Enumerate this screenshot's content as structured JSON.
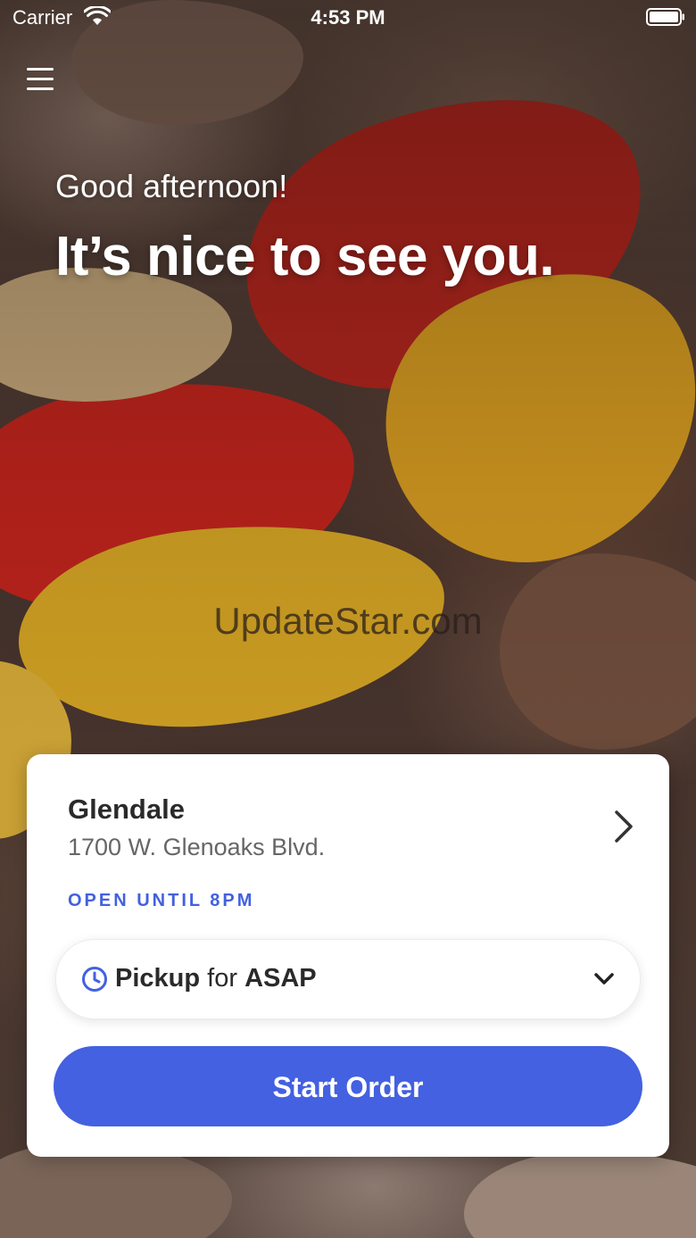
{
  "status_bar": {
    "carrier": "Carrier",
    "time": "4:53 PM"
  },
  "greeting": {
    "line1": "Good afternoon!",
    "line2": "It’s nice to see you."
  },
  "watermark": "UpdateStar.com",
  "location": {
    "name": "Glendale",
    "address": "1700 W. Glenoaks Blvd.",
    "hours": "OPEN UNTIL 8PM"
  },
  "order_type": {
    "mode": "Pickup",
    "connector": "for",
    "time": "ASAP"
  },
  "start_button": "Start Order",
  "colors": {
    "accent": "#4361e0",
    "card_bg": "#ffffff",
    "text_dark": "#2a2a2a",
    "text_muted": "#666666"
  },
  "icons": {
    "menu": "hamburger-menu-icon",
    "wifi": "wifi-icon",
    "battery": "battery-icon",
    "location_chevron": "chevron-right-icon",
    "clock": "clock-icon",
    "dropdown": "chevron-down-icon"
  }
}
